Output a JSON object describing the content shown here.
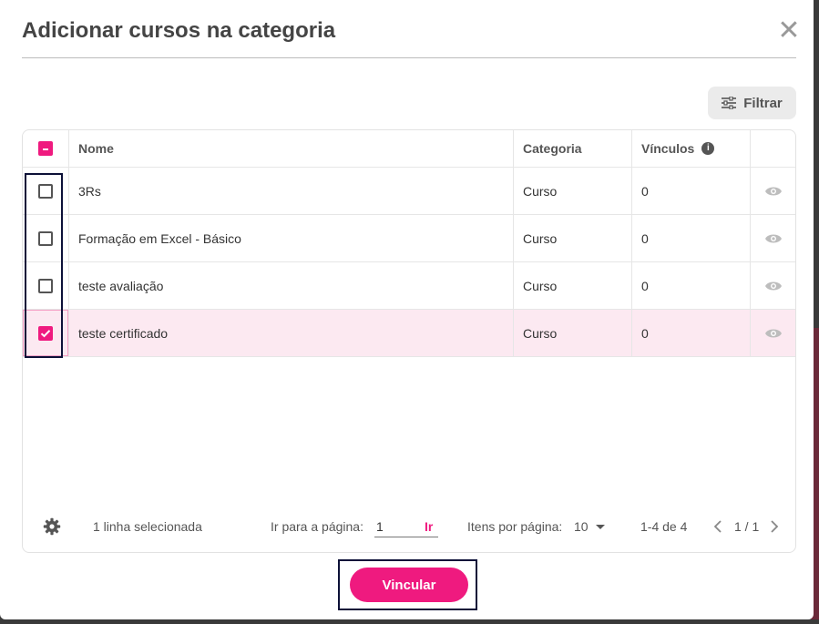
{
  "modal": {
    "title": "Adicionar cursos na categoria"
  },
  "toolbar": {
    "filter_label": "Filtrar"
  },
  "table": {
    "columns": {
      "name": "Nome",
      "category": "Categoria",
      "links": "Vínculos"
    },
    "rows": [
      {
        "name": "3Rs",
        "category": "Curso",
        "links": "0",
        "selected": false
      },
      {
        "name": "Formação em Excel - Básico",
        "category": "Curso",
        "links": "0",
        "selected": false
      },
      {
        "name": "teste avaliação",
        "category": "Curso",
        "links": "0",
        "selected": false
      },
      {
        "name": "teste certificado",
        "category": "Curso",
        "links": "0",
        "selected": true
      }
    ]
  },
  "footer": {
    "selected_text": "1 linha selecionada",
    "goto_label": "Ir para a página:",
    "goto_value": "1",
    "goto_button": "Ir",
    "per_page_label": "Itens por página:",
    "per_page_value": "10",
    "range_text": "1-4 de 4",
    "page_text": "1 / 1"
  },
  "actions": {
    "link_button": "Vincular"
  },
  "colors": {
    "accent": "#ef1a7f",
    "selected_row": "#fce9f1",
    "annotation_box": "#0d1138"
  },
  "icons": [
    "close-icon",
    "filter-icon",
    "info-icon",
    "eye-icon",
    "settings-gear-icon",
    "chevron-down-icon",
    "chevron-left-icon",
    "chevron-right-icon",
    "checkmark-icon"
  ]
}
